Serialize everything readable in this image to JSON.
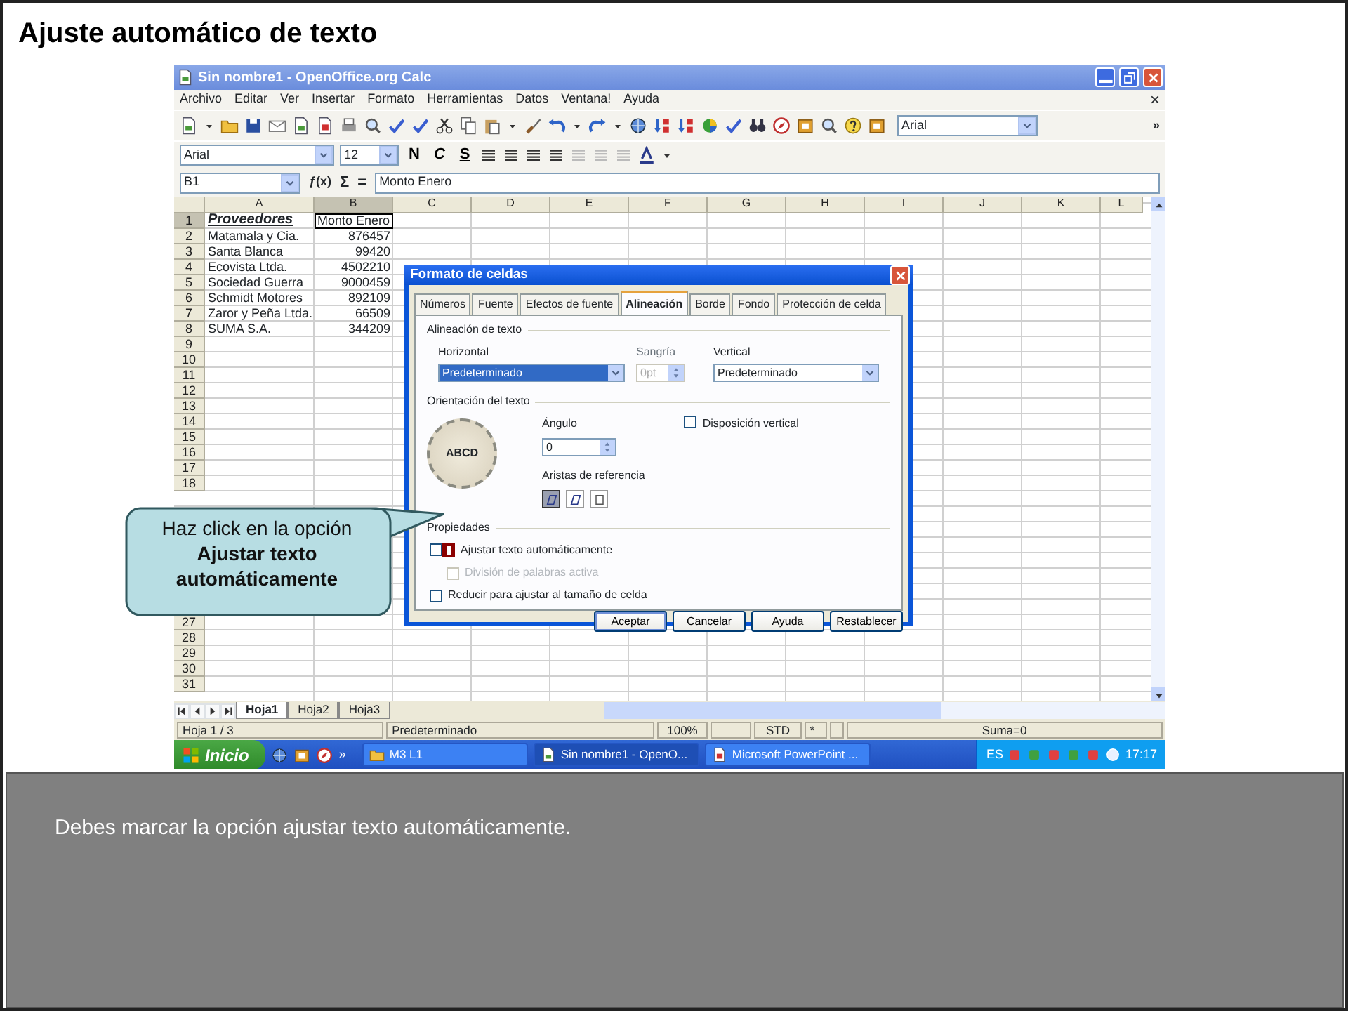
{
  "slide_title": "Ajuste automático de texto",
  "window": {
    "title": "Sin nombre1 - OpenOffice.org Calc"
  },
  "menu": [
    "Archivo",
    "Editar",
    "Ver",
    "Insertar",
    "Formato",
    "Herramientas",
    "Datos",
    "Ventana!",
    "Ayuda"
  ],
  "menu_close": "×",
  "toolbar": {
    "font": "Arial",
    "overflow": "»"
  },
  "format_toolbar": {
    "font": "Arial",
    "size": "12",
    "style_buttons": [
      "N",
      "C",
      "S"
    ]
  },
  "formula_bar": {
    "cell_ref": "B1",
    "buttons": [
      "ƒ(x)",
      "Σ",
      "="
    ],
    "value": "Monto Enero"
  },
  "columns": [
    {
      "label": "A",
      "selected": false
    },
    {
      "label": "B",
      "selected": true
    },
    {
      "label": "C",
      "selected": false
    },
    {
      "label": "D",
      "selected": false
    },
    {
      "label": "E",
      "selected": false
    },
    {
      "label": "F",
      "selected": false
    },
    {
      "label": "G",
      "selected": false
    },
    {
      "label": "H",
      "selected": false
    },
    {
      "label": "I",
      "selected": false
    },
    {
      "label": "J",
      "selected": false
    },
    {
      "label": "K",
      "selected": false
    },
    {
      "label": "L",
      "selected": false
    }
  ],
  "row_groups": [
    [
      {
        "number": "1",
        "cells": [
          {
            "kind": "heading",
            "text": "Proveedores",
            "selected": false
          },
          {
            "kind": "text",
            "text": "Monto Enero",
            "selected": true
          }
        ]
      },
      {
        "number": "2",
        "cells": [
          {
            "kind": "text",
            "text": "Matamala y Cia.",
            "selected": false
          },
          {
            "kind": "number",
            "text": "876457",
            "selected": false
          }
        ]
      },
      {
        "number": "3",
        "cells": [
          {
            "kind": "text",
            "text": "Santa Blanca",
            "selected": false
          },
          {
            "kind": "number",
            "text": "99420",
            "selected": false
          }
        ]
      },
      {
        "number": "4",
        "cells": [
          {
            "kind": "text",
            "text": "Ecovista Ltda.",
            "selected": false
          },
          {
            "kind": "number",
            "text": "4502210",
            "selected": false
          }
        ]
      },
      {
        "number": "5",
        "cells": [
          {
            "kind": "text",
            "text": "Sociedad Guerra",
            "selected": false
          },
          {
            "kind": "number",
            "text": "9000459",
            "selected": false
          }
        ]
      },
      {
        "number": "6",
        "cells": [
          {
            "kind": "text",
            "text": "Schmidt Motores",
            "selected": false
          },
          {
            "kind": "number",
            "text": "892109",
            "selected": false
          }
        ]
      },
      {
        "number": "7",
        "cells": [
          {
            "kind": "text",
            "text": "Zaror y Peña Ltda.",
            "selected": false
          },
          {
            "kind": "number",
            "text": "66509",
            "selected": false
          }
        ]
      },
      {
        "number": "8",
        "cells": [
          {
            "kind": "text",
            "text": "SUMA S.A.",
            "selected": false
          },
          {
            "kind": "number",
            "text": "344209",
            "selected": false
          }
        ]
      },
      {
        "number": "9"
      },
      {
        "number": "10"
      },
      {
        "number": "11"
      },
      {
        "number": "12"
      },
      {
        "number": "13"
      },
      {
        "number": "14"
      },
      {
        "number": "15"
      },
      {
        "number": "16"
      },
      {
        "number": "17"
      },
      {
        "number": "18"
      }
    ],
    [
      {
        "number": "27"
      },
      {
        "number": "28"
      },
      {
        "number": "29"
      },
      {
        "number": "30"
      },
      {
        "number": "31"
      }
    ]
  ],
  "sheet_tabs": [
    {
      "label": "Hoja1",
      "selected": true
    },
    {
      "label": "Hoja2",
      "selected": false
    },
    {
      "label": "Hoja3",
      "selected": false
    }
  ],
  "status_bar": [
    "Hoja 1 / 3",
    "Predeterminado",
    "100%",
    "STD",
    "*",
    "Suma=0"
  ],
  "taskbar": {
    "start": "Inicio",
    "quick_launch_more": "»",
    "tasks": [
      {
        "label": "M3 L1",
        "selected": false
      },
      {
        "label": "Sin nombre1 - OpenO...",
        "selected": true
      },
      {
        "label": "Microsoft PowerPoint ...",
        "selected": false
      }
    ],
    "language": "ES",
    "clock": "17:17"
  },
  "dialog": {
    "title": "Formato de celdas",
    "tabs": [
      {
        "label": "Números",
        "selected": false
      },
      {
        "label": "Fuente",
        "selected": false
      },
      {
        "label": "Efectos de fuente",
        "selected": false
      },
      {
        "label": "Alineación",
        "selected": true
      },
      {
        "label": "Borde",
        "selected": false
      },
      {
        "label": "Fondo",
        "selected": false
      },
      {
        "label": "Protección de celda",
        "selected": false
      }
    ],
    "text_alignment": {
      "heading": "Alineación de texto",
      "horizontal": {
        "label": "Horizontal",
        "value": "Predeterminado",
        "focused": true
      },
      "indent": {
        "label": "Sangría",
        "value": "0pt",
        "disabled": true
      },
      "vertical": {
        "label": "Vertical",
        "value": "Predeterminado",
        "focused": false
      }
    },
    "orientation": {
      "heading": "Orientación del texto",
      "dial_text": "ABCD",
      "angle": {
        "label": "Ángulo",
        "value": "0"
      },
      "vertical_stacking": {
        "label": "Disposición vertical",
        "checked": false
      },
      "reference_edges": {
        "label": "Aristas de referencia",
        "options": [
          {
            "selected": true
          },
          {
            "selected": false
          },
          {
            "selected": false
          }
        ]
      }
    },
    "properties": {
      "heading": "Propiedades",
      "options": [
        {
          "kind": "option",
          "label": "Ajustar texto automáticamente",
          "checked": false,
          "disabled": false,
          "highlighted": true
        },
        {
          "kind": "sub-option",
          "label": "División de palabras activa",
          "checked": false,
          "disabled": true,
          "highlighted": false
        },
        {
          "kind": "option",
          "label": "Reducir para ajustar al tamaño de celda",
          "checked": false,
          "disabled": false,
          "highlighted": false
        }
      ]
    },
    "buttons": [
      {
        "label": "Aceptar",
        "default": true
      },
      {
        "label": "Cancelar",
        "default": false
      },
      {
        "label": "Ayuda",
        "default": false
      },
      {
        "label": "Restablecer",
        "default": false
      }
    ]
  },
  "callout": "Haz click en la opción **Ajustar texto automáticamente**",
  "instruction": "Debes marcar la opción ajustar texto automáticamente."
}
